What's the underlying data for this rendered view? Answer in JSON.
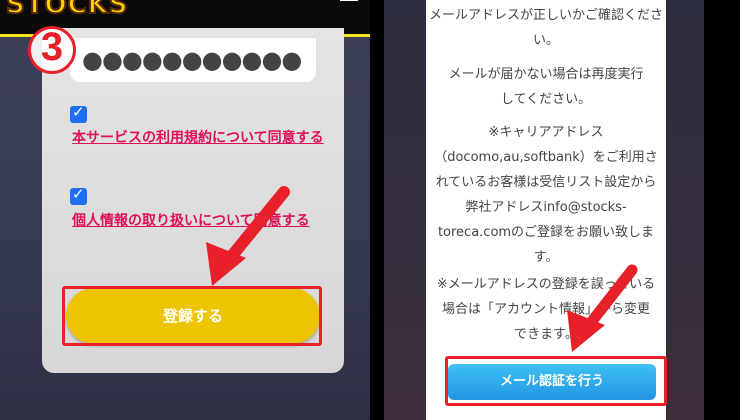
{
  "left": {
    "logo_text": "STOCKS",
    "step_number": "3",
    "password_masked": "●●●●●●●●●●●",
    "checkbox1_state": "checked",
    "checkbox1_label": "本サービスの利用規約について同意する",
    "checkbox2_state": "checked",
    "checkbox2_label": "個人情報の取り扱いについて同意する",
    "register_button": "登録する"
  },
  "right": {
    "p1": "メールアドレスが正しいかご確認ください。",
    "p2": "メールが届かない場合は再度実行してください。",
    "p3": "※キャリアアドレス（docomo,au,softbank）をご利用されているお客様は受信リスト設定から弊社アドレスinfo@stocks-toreca.comのご登録をお願い致します。",
    "p4": "※メールアドレスの登録を誤っている場合は「アカウント情報」から変更できます。",
    "mail_button": "メール認証を行う"
  },
  "colors": {
    "highlight": "#e8202a",
    "register_button": "#ecc400",
    "mail_button": "#2296e3",
    "link_text": "#e10f5a"
  }
}
